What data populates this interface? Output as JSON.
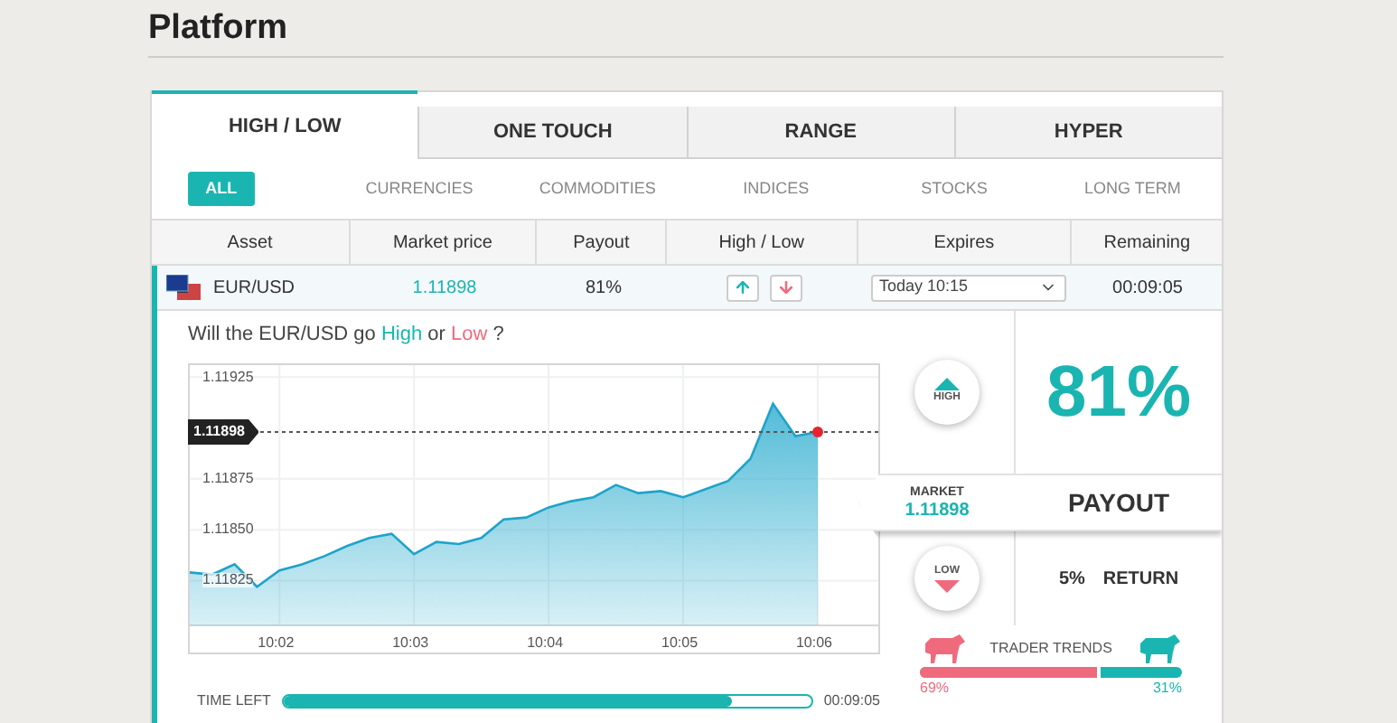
{
  "page_title": "Platform",
  "product_tabs": [
    {
      "label": "HIGH / LOW",
      "selected": true
    },
    {
      "label": "ONE TOUCH",
      "selected": false
    },
    {
      "label": "RANGE",
      "selected": false
    },
    {
      "label": "HYPER",
      "selected": false
    }
  ],
  "category_filters": [
    {
      "label": "ALL",
      "selected": true
    },
    {
      "label": "CURRENCIES",
      "selected": false
    },
    {
      "label": "COMMODITIES",
      "selected": false
    },
    {
      "label": "INDICES",
      "selected": false
    },
    {
      "label": "STOCKS",
      "selected": false
    },
    {
      "label": "LONG TERM",
      "selected": false
    }
  ],
  "table": {
    "columns": [
      "Asset",
      "Market price",
      "Payout",
      "High / Low",
      "Expires",
      "Remaining"
    ],
    "rows": [
      {
        "asset": "EUR/USD",
        "market_price": "1.11898",
        "payout": "81%",
        "expires": "Today 10:15",
        "remaining": "00:09:05",
        "expanded": true
      }
    ]
  },
  "trade_panel": {
    "question": {
      "prefix": "Will the EUR/USD go",
      "high": "High",
      "middle": "or",
      "low": "Low",
      "suffix": "?"
    },
    "chart_data": {
      "type": "area",
      "categories": [
        null,
        null,
        null,
        null,
        "10:02",
        null,
        null,
        null,
        null,
        null,
        "10:03",
        null,
        null,
        null,
        null,
        null,
        "10:04",
        null,
        null,
        null,
        null,
        null,
        "10:05",
        null,
        null,
        null,
        null,
        null,
        "10:06"
      ],
      "series": [
        {
          "color": "#3fb4d3",
          "values": [
            1.11829,
            1.11828,
            1.11833,
            1.11822,
            1.1183,
            1.11833,
            1.11837,
            1.11842,
            1.11846,
            1.11848,
            1.11838,
            1.11844,
            1.11843,
            1.11846,
            1.11855,
            1.11856,
            1.11861,
            1.11864,
            1.11866,
            1.11872,
            1.11868,
            1.11869,
            1.11866,
            1.1187,
            1.11874,
            1.11885,
            1.11912,
            1.11896,
            1.11898
          ]
        }
      ],
      "ylim": [
        1.11803,
        1.1193
      ],
      "grid": true,
      "ref_lines": [
        {
          "value": 1.11898,
          "axis": "y",
          "label": "1.11898"
        }
      ],
      "yticks": [
        {
          "value": 1.11925,
          "label": "1.11925"
        },
        {
          "value": 1.11875,
          "label": "1.11875"
        },
        {
          "value": 1.1185,
          "label": "1.11850"
        },
        {
          "value": 1.11825,
          "label": "1.11825"
        }
      ]
    },
    "time_left": {
      "label": "TIME LEFT",
      "level": 0.85,
      "reading": "00:09:05"
    },
    "high_button": "HIGH",
    "low_button": "LOW",
    "payout_percent": "81%",
    "market": {
      "label": "MARKET",
      "value": "1.11898"
    },
    "payout_label": "PAYOUT",
    "return": {
      "percent": "5%",
      "label": "RETURN"
    },
    "trader_trends": {
      "title": "TRADER TRENDS",
      "level": 0.69,
      "low_reading": "69%",
      "high_reading": "31%"
    }
  }
}
